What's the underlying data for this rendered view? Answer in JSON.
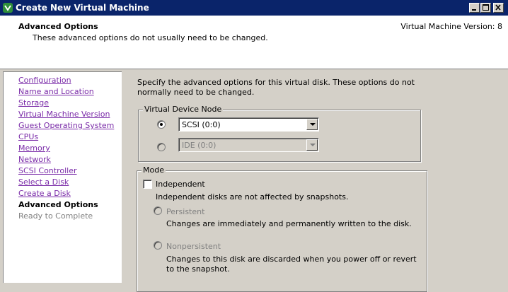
{
  "window": {
    "title": "Create New Virtual Machine",
    "buttons": [
      "minimize",
      "maximize",
      "close"
    ]
  },
  "header": {
    "title": "Advanced Options",
    "subtitle": "These advanced options do not usually need to be changed.",
    "version_text": "Virtual Machine Version: 8"
  },
  "nav": {
    "items": [
      {
        "label": "Configuration",
        "state": "link"
      },
      {
        "label": "Name and Location",
        "state": "link"
      },
      {
        "label": "Storage",
        "state": "link"
      },
      {
        "label": "Virtual Machine Version",
        "state": "link"
      },
      {
        "label": "Guest Operating System",
        "state": "link"
      },
      {
        "label": "CPUs",
        "state": "link"
      },
      {
        "label": "Memory",
        "state": "link"
      },
      {
        "label": "Network",
        "state": "link"
      },
      {
        "label": "SCSI Controller",
        "state": "link"
      },
      {
        "label": "Select a Disk",
        "state": "link"
      },
      {
        "label": "Create a Disk",
        "state": "link"
      },
      {
        "label": "Advanced Options",
        "state": "current"
      },
      {
        "label": "Ready to Complete",
        "state": "disabled"
      }
    ]
  },
  "content": {
    "intro": "Specify the advanced options for this virtual disk. These options do not normally need to be changed.",
    "device_node": {
      "legend": "Virtual Device Node",
      "scsi": {
        "value": "SCSI (0:0)",
        "selected": true,
        "enabled": true
      },
      "ide": {
        "value": "IDE (0:0)",
        "selected": false,
        "enabled": false
      }
    },
    "mode": {
      "legend": "Mode",
      "independent_label": "Independent",
      "independent_checked": false,
      "independent_desc": "Independent disks are not affected by snapshots.",
      "persistent_label": "Persistent",
      "persistent_desc": "Changes are immediately and permanently written to the disk.",
      "nonpersistent_label": "Nonpersistent",
      "nonpersistent_desc": "Changes to this disk are discarded when you power off or revert to the snapshot."
    }
  },
  "colors": {
    "titlebar": "#0a246a",
    "link": "#7a2ba8",
    "face": "#d4d0c8"
  }
}
